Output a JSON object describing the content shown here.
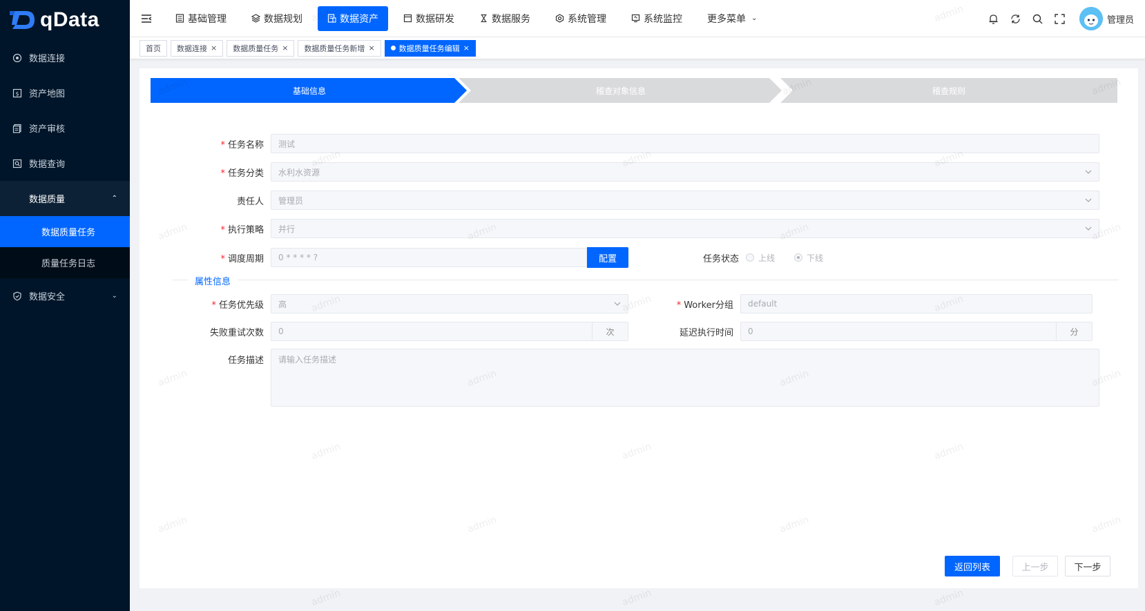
{
  "app": {
    "name": "qData"
  },
  "sidebar": {
    "items": [
      {
        "label": "数据连接",
        "icon": "target-icon"
      },
      {
        "label": "资产地图",
        "icon": "asset-map-icon"
      },
      {
        "label": "资产审核",
        "icon": "audit-icon"
      },
      {
        "label": "数据查询",
        "icon": "query-icon"
      },
      {
        "label": "数据质量",
        "icon": "",
        "expanded": true
      },
      {
        "label": "数据安全",
        "icon": "shield-icon"
      }
    ],
    "submenu": [
      {
        "label": "数据质量任务",
        "active": true
      },
      {
        "label": "质量任务日志",
        "active": false
      }
    ]
  },
  "topnav": {
    "items": [
      {
        "label": "基础管理",
        "icon": "calculator-icon"
      },
      {
        "label": "数据规划",
        "icon": "layers-icon"
      },
      {
        "label": "数据资产",
        "icon": "asset-icon",
        "active": true
      },
      {
        "label": "数据研发",
        "icon": "window-icon"
      },
      {
        "label": "数据服务",
        "icon": "hourglass-icon"
      },
      {
        "label": "系统管理",
        "icon": "hexagon-gear-icon"
      },
      {
        "label": "系统监控",
        "icon": "monitor-icon"
      },
      {
        "label": "更多菜单",
        "icon": "chevron-down-icon"
      }
    ],
    "user": "管理员"
  },
  "tags": [
    {
      "label": "首页",
      "closable": false
    },
    {
      "label": "数据连接",
      "closable": true
    },
    {
      "label": "数据质量任务",
      "closable": true
    },
    {
      "label": "数据质量任务新增",
      "closable": true
    },
    {
      "label": "数据质量任务编辑",
      "closable": true,
      "active": true
    }
  ],
  "steps": [
    "基础信息",
    "稽查对象信息",
    "稽查规则"
  ],
  "form": {
    "task_name": {
      "label": "任务名称",
      "value": "测试"
    },
    "task_category": {
      "label": "任务分类",
      "value": "水利水资源"
    },
    "owner": {
      "label": "责任人",
      "value": "管理员"
    },
    "strategy": {
      "label": "执行策略",
      "value": "并行"
    },
    "schedule": {
      "label": "调度周期",
      "value": "0 * * * * ?",
      "button": "配置"
    },
    "status": {
      "label": "任务状态",
      "options": [
        "上线",
        "下线"
      ],
      "selected": "下线"
    },
    "section_title": "属性信息",
    "priority": {
      "label": "任务优先级",
      "value": "高"
    },
    "worker_group": {
      "label": "Worker分组",
      "value": "default"
    },
    "retry": {
      "label": "失败重试次数",
      "value": "0",
      "unit": "次"
    },
    "delay": {
      "label": "延迟执行时间",
      "value": "0",
      "unit": "分"
    },
    "description": {
      "label": "任务描述",
      "placeholder": "请输入任务描述"
    }
  },
  "actions": {
    "back": "返回列表",
    "prev": "上一步",
    "next": "下一步"
  },
  "watermark": "admin"
}
